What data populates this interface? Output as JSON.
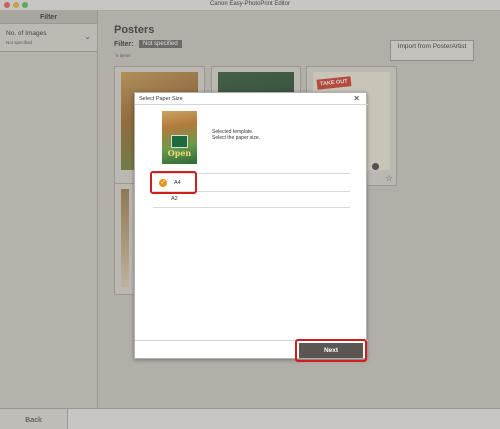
{
  "window": {
    "title": "Canon Easy-PhotoPrint Editor"
  },
  "sidebar": {
    "header": "Filter",
    "filters": [
      {
        "label": "No. of Images",
        "value": "Not specified"
      }
    ]
  },
  "main": {
    "title": "Posters",
    "filter_label": "Filter:",
    "filter_value": "Not specified",
    "items_count": "5 items",
    "import_button": "Import from PosterArtist",
    "thumb_texts": {
      "take_out": "TAKE OUT"
    }
  },
  "dialog": {
    "title": "Select Paper Size",
    "close_glyph": "✕",
    "template_open": "Open",
    "line1": "Selected template.",
    "line2": "Select the paper size.",
    "options": [
      "A4",
      "A2"
    ],
    "selected_option": "A4",
    "next_button": "Next"
  },
  "footer": {
    "back_button": "Back"
  },
  "colors": {
    "accent_highlight": "#d01d1d",
    "check_orange": "#e8941a",
    "next_bg": "#5b5651"
  },
  "icons": [
    "chevron-down-icon",
    "close-icon",
    "check-icon",
    "star-icon",
    "magnifier-icon"
  ]
}
